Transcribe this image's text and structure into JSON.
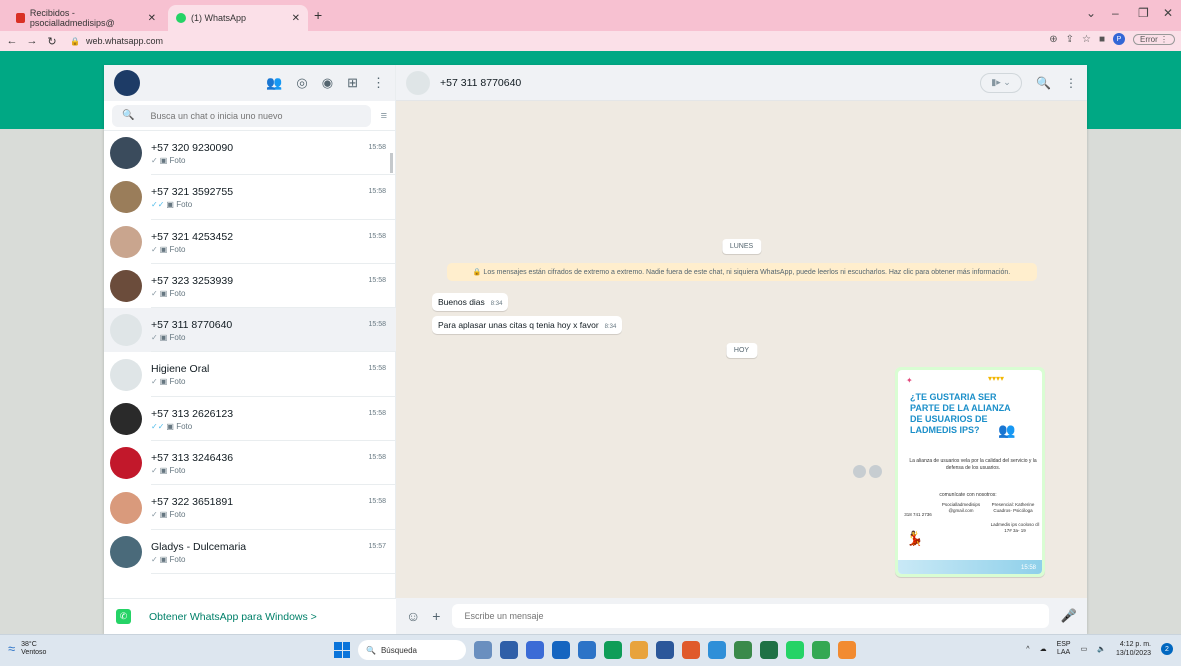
{
  "browser": {
    "tabs": [
      {
        "title": "Recibidos - psocialladmedisips@",
        "active": false,
        "favicon_color": "#d93025"
      },
      {
        "title": "(1) WhatsApp",
        "active": true,
        "favicon_color": "#25d366"
      }
    ],
    "url": "web.whatsapp.com",
    "error_label": "Error",
    "profile_letter": "P"
  },
  "sidebar": {
    "search_placeholder": "Busca un chat o inicia uno nuevo",
    "chats": [
      {
        "name": "+57 320 9230090",
        "preview": "Foto",
        "time": "15:58",
        "read": false,
        "avatar_color": "#3a4b5c"
      },
      {
        "name": "+57 321 3592755",
        "preview": "Foto",
        "time": "15:58",
        "read": true,
        "avatar_color": "#9a7d5a"
      },
      {
        "name": "+57 321 4253452",
        "preview": "Foto",
        "time": "15:58",
        "read": false,
        "avatar_color": "#c9a58e"
      },
      {
        "name": "+57 323 3253939",
        "preview": "Foto",
        "time": "15:58",
        "read": false,
        "avatar_color": "#6b4c3b"
      },
      {
        "name": "+57 311 8770640",
        "preview": "Foto",
        "time": "15:58",
        "read": false,
        "avatar_color": "#dfe5e7"
      },
      {
        "name": "Higiene Oral",
        "preview": "Foto",
        "time": "15:58",
        "read": false,
        "avatar_color": "#dfe5e7"
      },
      {
        "name": "+57 313 2626123",
        "preview": "Foto",
        "time": "15:58",
        "read": true,
        "avatar_color": "#2a2a2a"
      },
      {
        "name": "+57 313 3246436",
        "preview": "Foto",
        "time": "15:58",
        "read": false,
        "avatar_color": "#c2182b"
      },
      {
        "name": "+57 322 3651891",
        "preview": "Foto",
        "time": "15:58",
        "read": false,
        "avatar_color": "#d99a7c"
      },
      {
        "name": "Gladys - Dulcemaria",
        "preview": "Foto",
        "time": "15:57",
        "read": false,
        "avatar_color": "#4a6a7a"
      }
    ],
    "footer_link": "Obtener WhatsApp para Windows >"
  },
  "conversation": {
    "contact": "+57 311 8770640",
    "day_label_1": "LUNES",
    "encryption_notice": "Los mensajes están cifrados de extremo a extremo. Nadie fuera de este chat, ni siquiera WhatsApp, puede leerlos ni escucharlos. Haz clic para obtener más información.",
    "messages": [
      {
        "text": "Buenos dias",
        "time": "8:34"
      },
      {
        "text": "Para aplasar unas citas q tenia hoy x favor",
        "time": "8:34"
      }
    ],
    "day_label_2": "HOY",
    "flyer": {
      "headline": "¿TE GUSTARIA SER PARTE DE LA ALIANZA DE USUARIOS DE LADMEDIS IPS?",
      "paragraph": "La alianza de usuarios vela por la calidad del servicio y la defensa de los usuarios.",
      "contact_title": "comunícate con nosotros:",
      "phone": "318 741 2736",
      "email": "Psocialladmedisips @gmail.com",
      "presencial": "Presencial: Katherine Cuadros- Psicóloga",
      "address": "Ladmedis ips cooloso cll 17# 3a- 19",
      "time": "15:58"
    },
    "input_placeholder": "Escribe un mensaje"
  },
  "taskbar": {
    "temperature": "38°C",
    "weather": "Ventoso",
    "search_label": "Búsqueda",
    "lang_1": "ESP",
    "lang_2": "LAA",
    "time": "4:12 p. m.",
    "date": "13/10/2023",
    "notification_count": "2",
    "apps": [
      "#6a8fbf",
      "#2f5fa8",
      "#3b6bd6",
      "#1565c0",
      "#2c73c7",
      "#0f9d58",
      "#e8a33d",
      "#2b579a",
      "#e05a2b",
      "#2f8fd8",
      "#3a8a4a",
      "#1e7145",
      "#25d366",
      "#34a853",
      "#f28b30"
    ]
  }
}
